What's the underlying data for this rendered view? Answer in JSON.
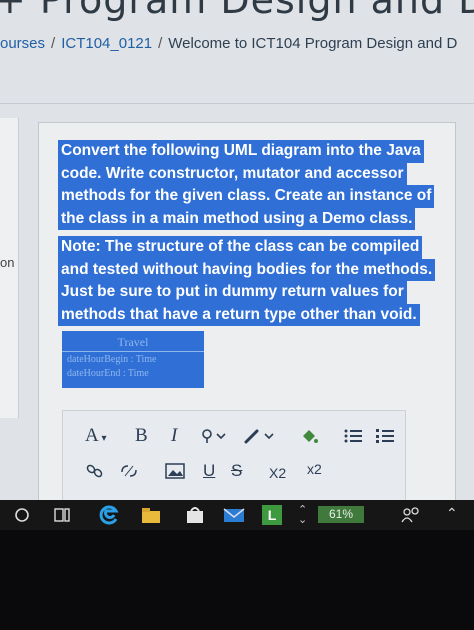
{
  "page": {
    "title_fragment": "+ Program Design and Devel",
    "breadcrumb": [
      "ourses",
      "ICT104_0121",
      "Welcome to ICT104 Program Design and D"
    ],
    "breadcrumb_separator": "/",
    "side_label": "on"
  },
  "question": {
    "paragraph1": [
      "Convert the following UML diagram into the Java",
      "code. Write constructor, mutator and accessor",
      "methods for the given class. Create an instance of",
      "the class in a main method using a Demo class."
    ],
    "paragraph2": [
      "Note: The structure of the class can be compiled",
      "and tested without having bodies for the methods.",
      "Just be sure to put in dummy return values for",
      "methods that have a return type other than void."
    ]
  },
  "uml": {
    "class_name": "Travel",
    "attributes": [
      "dateHourBegin : Time",
      "dateHourEnd : Time"
    ]
  },
  "editor_toolbar": {
    "font_size_label": "A",
    "bold_label": "B",
    "italic_label": "I",
    "underline_label": "U",
    "strike_label": "S",
    "subscript_label": "X2",
    "superscript_label": "x2",
    "icons": [
      "font-size-icon",
      "bold-icon",
      "italic-icon",
      "text-color-icon",
      "highlight-icon",
      "paint-bucket-icon",
      "bullet-list-icon",
      "numbered-list-icon",
      "link-icon",
      "unlink-icon",
      "image-icon",
      "underline-icon",
      "strikethrough-icon",
      "subscript-icon",
      "superscript-icon"
    ]
  },
  "taskbar": {
    "battery": "61%",
    "icons": [
      "search-circle-icon",
      "task-view-icon",
      "edge-icon",
      "file-explorer-icon",
      "store-icon",
      "mail-icon",
      "app-l-icon",
      "scroll-arrows-icon",
      "people-icon",
      "chevron-up-icon"
    ],
    "app_letter": "L"
  },
  "colors": {
    "selection": "#2f6fd6",
    "link": "#1f5fa6",
    "battery": "#3f7a3c",
    "page_bg": "#dfe3e7"
  }
}
